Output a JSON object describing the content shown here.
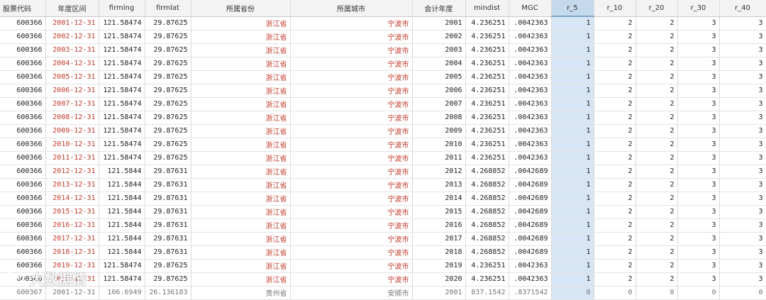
{
  "columns": [
    "股票代码",
    "年度区间",
    "firmlng",
    "firmlat",
    "所属省份",
    "所属城市",
    "会计年度",
    "mindist",
    "MGC",
    "r_5",
    "r_10",
    "r_20",
    "r_30",
    "r_40"
  ],
  "rows": [
    [
      "600366",
      "2001-12-31",
      "121.58474",
      "29.87625",
      "浙江省",
      "宁波市",
      "2001",
      "4.236251",
      ".0042363",
      "1",
      "2",
      "2",
      "3",
      "3"
    ],
    [
      "600366",
      "2002-12-31",
      "121.58474",
      "29.87625",
      "浙江省",
      "宁波市",
      "2002",
      "4.236251",
      ".0042363",
      "1",
      "2",
      "2",
      "3",
      "3"
    ],
    [
      "600366",
      "2003-12-31",
      "121.58474",
      "29.87625",
      "浙江省",
      "宁波市",
      "2003",
      "4.236251",
      ".0042363",
      "1",
      "2",
      "2",
      "3",
      "3"
    ],
    [
      "600366",
      "2004-12-31",
      "121.58474",
      "29.87625",
      "浙江省",
      "宁波市",
      "2004",
      "4.236251",
      ".0042363",
      "1",
      "2",
      "2",
      "3",
      "3"
    ],
    [
      "600366",
      "2005-12-31",
      "121.58474",
      "29.87625",
      "浙江省",
      "宁波市",
      "2005",
      "4.236251",
      ".0042363",
      "1",
      "2",
      "2",
      "3",
      "3"
    ],
    [
      "600366",
      "2006-12-31",
      "121.58474",
      "29.87625",
      "浙江省",
      "宁波市",
      "2006",
      "4.236251",
      ".0042363",
      "1",
      "2",
      "2",
      "3",
      "3"
    ],
    [
      "600366",
      "2007-12-31",
      "121.58474",
      "29.87625",
      "浙江省",
      "宁波市",
      "2007",
      "4.236251",
      ".0042363",
      "1",
      "2",
      "2",
      "3",
      "3"
    ],
    [
      "600366",
      "2008-12-31",
      "121.58474",
      "29.87625",
      "浙江省",
      "宁波市",
      "2008",
      "4.236251",
      ".0042363",
      "1",
      "2",
      "2",
      "3",
      "3"
    ],
    [
      "600366",
      "2009-12-31",
      "121.58474",
      "29.87625",
      "浙江省",
      "宁波市",
      "2009",
      "4.236251",
      ".0042363",
      "1",
      "2",
      "2",
      "3",
      "3"
    ],
    [
      "600366",
      "2010-12-31",
      "121.58474",
      "29.87625",
      "浙江省",
      "宁波市",
      "2010",
      "4.236251",
      ".0042363",
      "1",
      "2",
      "2",
      "3",
      "3"
    ],
    [
      "600366",
      "2011-12-31",
      "121.58474",
      "29.87625",
      "浙江省",
      "宁波市",
      "2011",
      "4.236251",
      ".0042363",
      "1",
      "2",
      "2",
      "3",
      "3"
    ],
    [
      "600366",
      "2012-12-31",
      "121.5844",
      "29.87631",
      "浙江省",
      "宁波市",
      "2012",
      "4.268852",
      ".0042689",
      "1",
      "2",
      "2",
      "3",
      "3"
    ],
    [
      "600366",
      "2013-12-31",
      "121.5844",
      "29.87631",
      "浙江省",
      "宁波市",
      "2013",
      "4.268852",
      ".0042689",
      "1",
      "2",
      "2",
      "3",
      "3"
    ],
    [
      "600366",
      "2014-12-31",
      "121.5844",
      "29.87631",
      "浙江省",
      "宁波市",
      "2014",
      "4.268852",
      ".0042689",
      "1",
      "2",
      "2",
      "3",
      "3"
    ],
    [
      "600366",
      "2015-12-31",
      "121.5844",
      "29.87631",
      "浙江省",
      "宁波市",
      "2015",
      "4.268852",
      ".0042689",
      "1",
      "2",
      "2",
      "3",
      "3"
    ],
    [
      "600366",
      "2016-12-31",
      "121.5844",
      "29.87631",
      "浙江省",
      "宁波市",
      "2016",
      "4.268852",
      ".0042689",
      "1",
      "2",
      "2",
      "3",
      "3"
    ],
    [
      "600366",
      "2017-12-31",
      "121.5844",
      "29.87631",
      "浙江省",
      "宁波市",
      "2017",
      "4.268852",
      ".0042689",
      "1",
      "2",
      "2",
      "3",
      "3"
    ],
    [
      "600366",
      "2018-12-31",
      "121.5844",
      "29.87631",
      "浙江省",
      "宁波市",
      "2018",
      "4.268852",
      ".0042689",
      "1",
      "2",
      "2",
      "3",
      "3"
    ],
    [
      "600366",
      "2019-12-31",
      "121.58474",
      "29.87625",
      "浙江省",
      "宁波市",
      "2019",
      "4.236251",
      ".0042363",
      "1",
      "2",
      "2",
      "3",
      "3"
    ],
    [
      "600366",
      "2020-12-31",
      "121.58474",
      "29.87625",
      "浙江省",
      "宁波市",
      "2020",
      "4.236251",
      ".0042363",
      "1",
      "2",
      "2",
      "3",
      "3"
    ],
    [
      "600367",
      "2001-12-31",
      "106.6949",
      "26.136183",
      "贵州省",
      "安顺市",
      "2001",
      "837.1542",
      ".8371542",
      "0",
      "0",
      "0",
      "0",
      "0"
    ]
  ],
  "selected_column": "r_5",
  "watermark": "大数据情",
  "colors": {
    "text_red": "#c0392b",
    "selected_col_bg": "#d6e6f4",
    "selected_header_bg": "#c5d9ec",
    "header_bg": "#f3f3f3"
  }
}
